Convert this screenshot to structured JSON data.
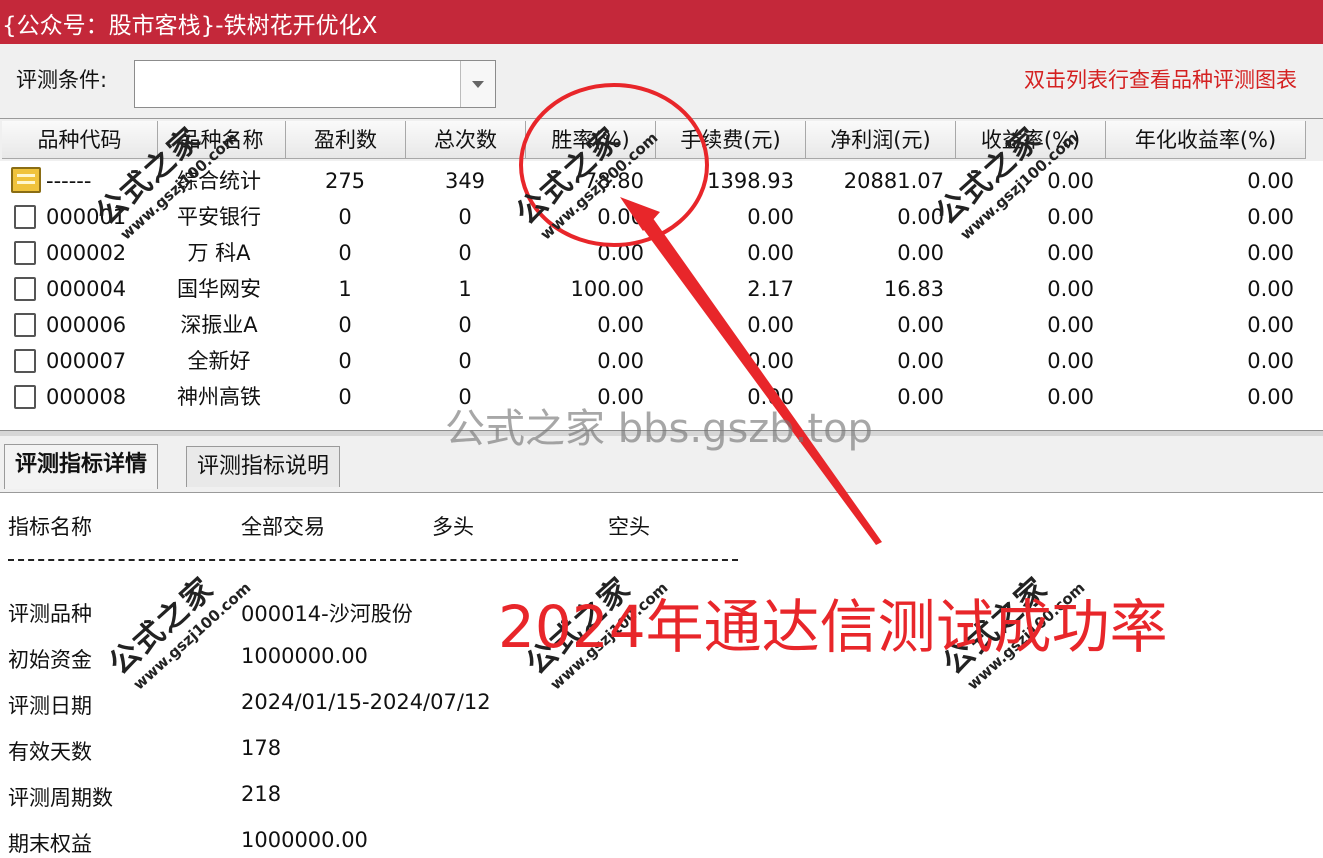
{
  "window": {
    "title": "{公众号：股市客栈}-铁树花开优化X"
  },
  "filter": {
    "label": "评测条件:",
    "value": "",
    "hint": "双击列表行查看品种评测图表"
  },
  "table": {
    "columns": [
      "品种代码",
      "品种名称",
      "盈利数",
      "总次数",
      "胜率(%)",
      "手续费(元)",
      "净利润(元)",
      "收益率(%)",
      "年化收益率(%)"
    ],
    "rows": [
      {
        "code": "------",
        "name": "综合统计",
        "profit_count": "275",
        "total": "349",
        "win_rate": "78.80",
        "fee": "1398.93",
        "net_profit": "20881.07",
        "return": "0.00",
        "annual_return": "0.00"
      },
      {
        "code": "000001",
        "name": "平安银行",
        "profit_count": "0",
        "total": "0",
        "win_rate": "0.00",
        "fee": "0.00",
        "net_profit": "0.00",
        "return": "0.00",
        "annual_return": "0.00"
      },
      {
        "code": "000002",
        "name": "万 科A",
        "profit_count": "0",
        "total": "0",
        "win_rate": "0.00",
        "fee": "0.00",
        "net_profit": "0.00",
        "return": "0.00",
        "annual_return": "0.00"
      },
      {
        "code": "000004",
        "name": "国华网安",
        "profit_count": "1",
        "total": "1",
        "win_rate": "100.00",
        "fee": "2.17",
        "net_profit": "16.83",
        "return": "0.00",
        "annual_return": "0.00"
      },
      {
        "code": "000006",
        "name": "深振业A",
        "profit_count": "0",
        "total": "0",
        "win_rate": "0.00",
        "fee": "0.00",
        "net_profit": "0.00",
        "return": "0.00",
        "annual_return": "0.00"
      },
      {
        "code": "000007",
        "name": "全新好",
        "profit_count": "0",
        "total": "0",
        "win_rate": "0.00",
        "fee": "0.00",
        "net_profit": "0.00",
        "return": "0.00",
        "annual_return": "0.00"
      },
      {
        "code": "000008",
        "name": "神州高铁",
        "profit_count": "0",
        "total": "0",
        "win_rate": "0.00",
        "fee": "0.00",
        "net_profit": "0.00",
        "return": "0.00",
        "annual_return": "0.00"
      }
    ]
  },
  "tabs": [
    "评测指标详情",
    "评测指标说明"
  ],
  "detail": {
    "header": [
      "指标名称",
      "全部交易",
      "多头",
      "空头"
    ],
    "items": [
      {
        "label": "评测品种",
        "value": "000014-沙河股份"
      },
      {
        "label": "初始资金",
        "value": "1000000.00"
      },
      {
        "label": "评测日期",
        "value": "2024/01/15-2024/07/12"
      },
      {
        "label": "有效天数",
        "value": "178"
      },
      {
        "label": "评测周期数",
        "value": "218"
      },
      {
        "label": "期末权益",
        "value": "1000000.00"
      }
    ]
  },
  "overlay": {
    "watermark_text": "公式之家",
    "watermark_url": "www.gszj100.com",
    "center_watermark": "公式之家 bbs.gszb.top",
    "annotation": "2024年通达信测试成功率",
    "annotation_color": "#e8262a"
  }
}
